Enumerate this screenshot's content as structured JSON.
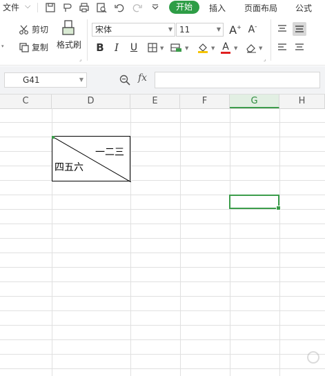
{
  "menubar": {
    "file_label": "文件",
    "tabs": [
      "开始",
      "插入",
      "页面布局",
      "公式"
    ]
  },
  "ribbon": {
    "cut_label": "剪切",
    "copy_label": "复制",
    "format_painter_label": "格式刷",
    "font_name": "宋体",
    "font_size": "11",
    "bold_label": "B",
    "italic_label": "I",
    "underline_label": "U",
    "font_color_label": "A"
  },
  "formula_bar": {
    "name_box": "G41",
    "fx_label": "fx",
    "formula": ""
  },
  "columns": [
    "C",
    "D",
    "E",
    "F",
    "G",
    "H"
  ],
  "active_column": "G",
  "merged_cell": {
    "top_right_text": "一二三",
    "bottom_left_text": "四五六"
  },
  "colors": {
    "accent_green": "#2e9d46",
    "font_color_red": "#e02020",
    "fill_yellow": "#f5c400"
  }
}
